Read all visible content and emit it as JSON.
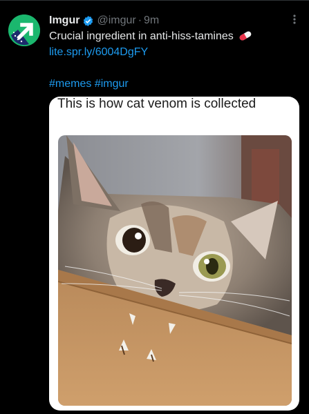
{
  "tweet": {
    "author_name": "Imgur",
    "handle": "@imgur",
    "separator": "·",
    "time": "9m",
    "text": "Crucial ingredient in anti-hiss-tamines",
    "link": "lite.spr.ly/6004DgFY",
    "hashtags": [
      "#memes",
      "#imgur"
    ]
  },
  "media": {
    "caption": "This is how cat venom is collected"
  },
  "icons": {
    "avatar": "imgur-logo-icon",
    "verified": "verified-badge-icon",
    "more": "more-options-icon",
    "emoji": "pill-emoji-icon"
  },
  "colors": {
    "background": "#000000",
    "text": "#e7e9ea",
    "muted": "#71767b",
    "link": "#1d9bf0",
    "brand": "#1bb76e"
  }
}
